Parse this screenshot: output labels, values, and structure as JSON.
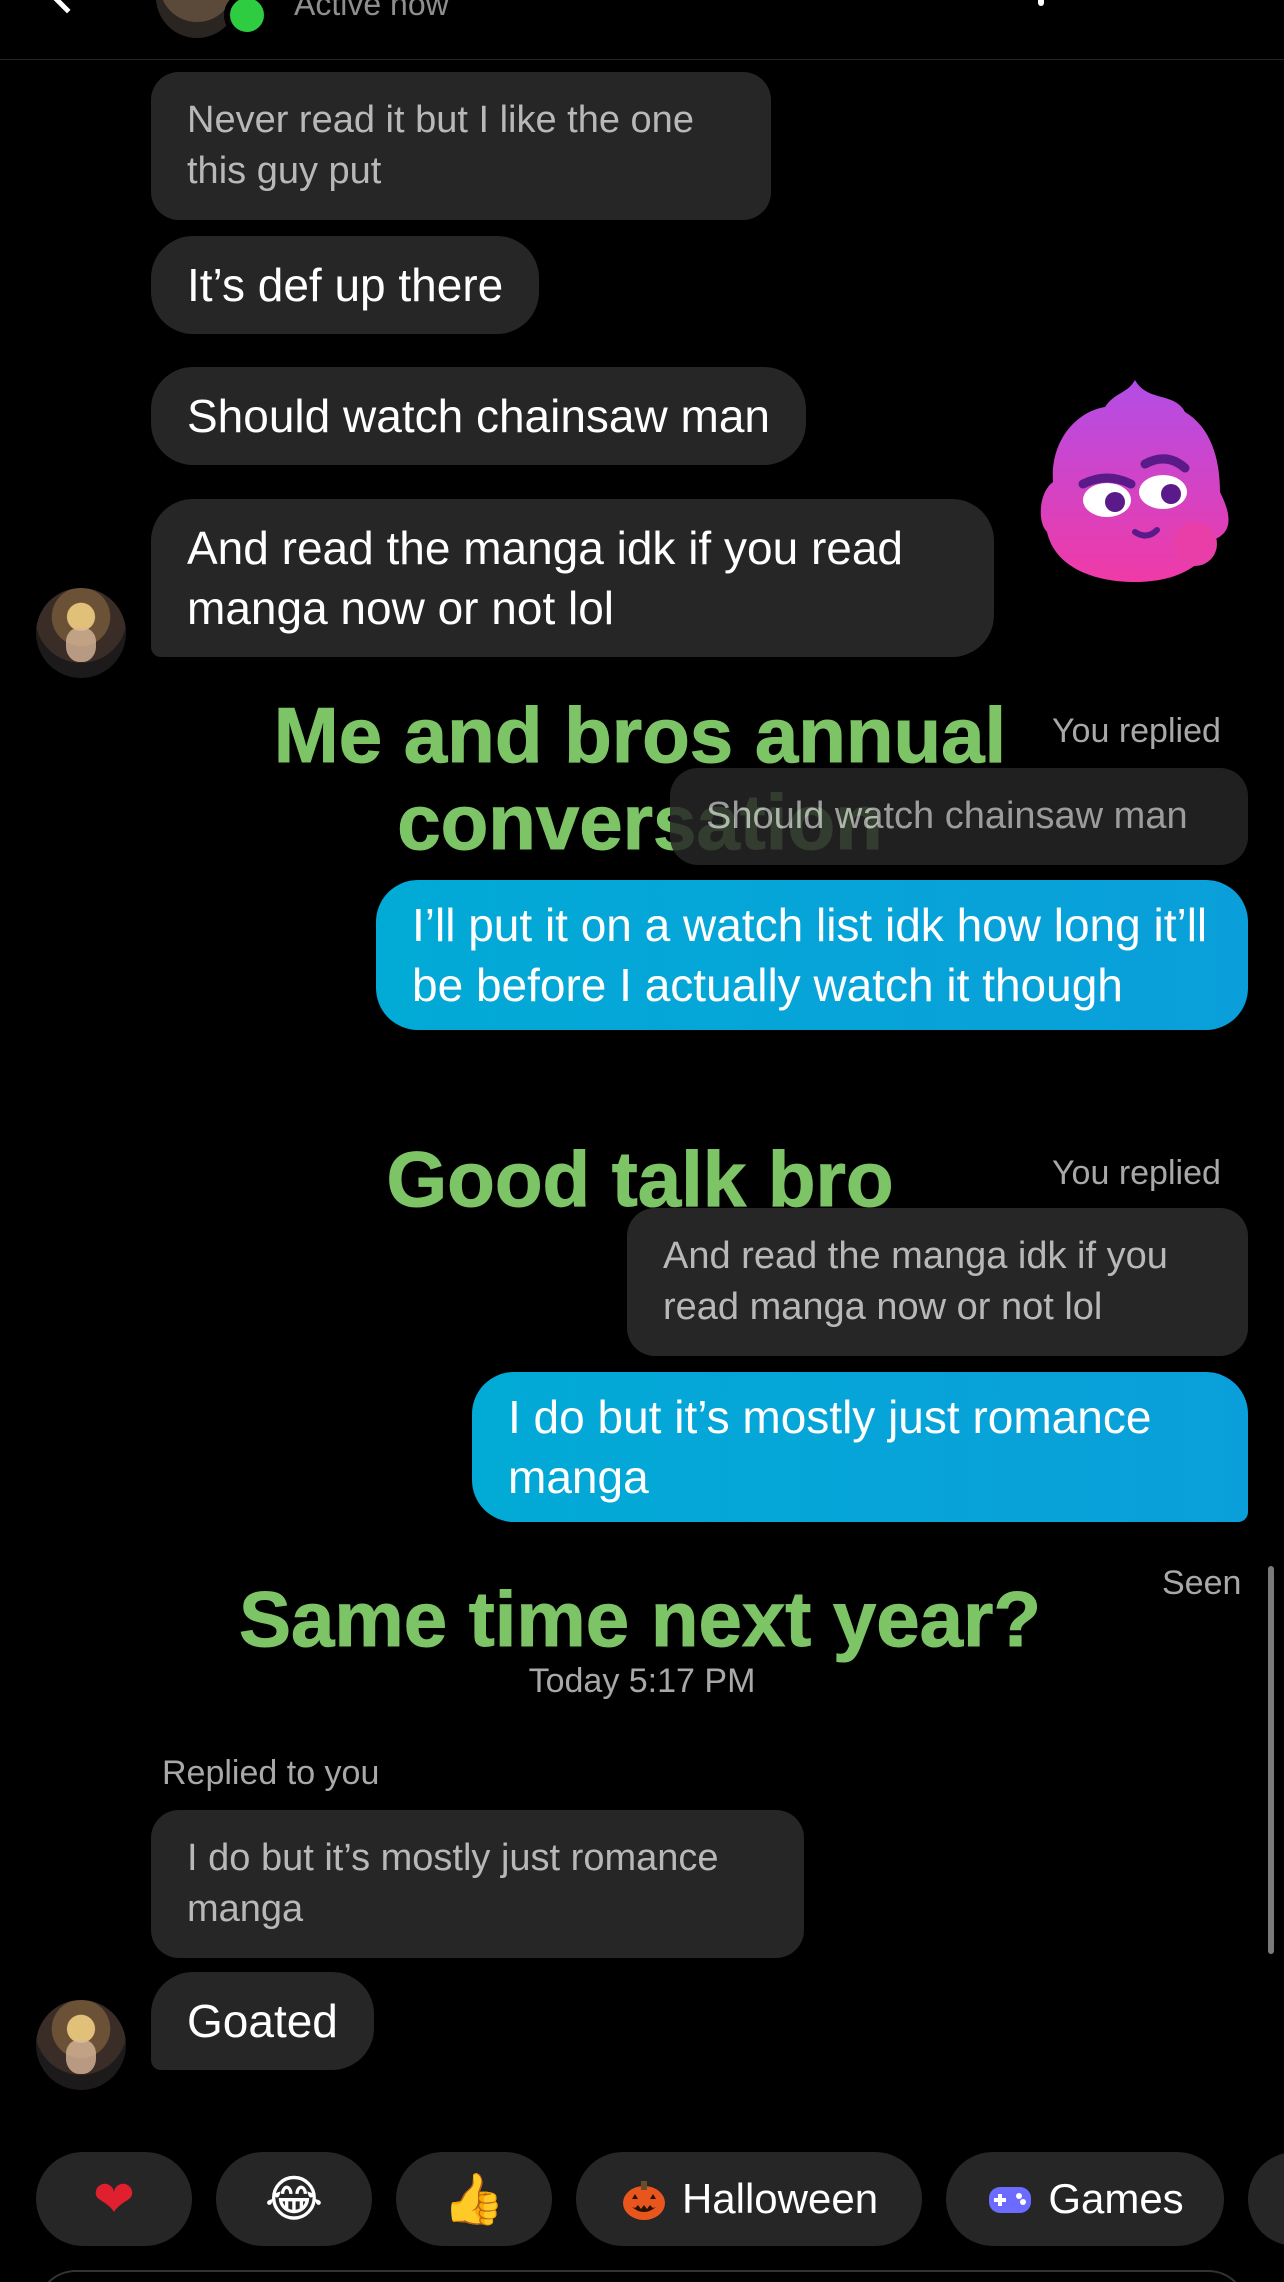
{
  "header": {
    "status": "Active now"
  },
  "messages": {
    "m1": "Never read it but I like the one this guy put",
    "m2": "It’s def up there",
    "m3": "Should watch chainsaw man",
    "m4": "And read the manga idk if you read manga now or not lol",
    "reply1_label": "You replied",
    "reply1_quote": "Should watch chainsaw man",
    "m5": "I’ll put it on a watch list idk how long it’ll be before I actually watch it though",
    "reply2_label": "You replied",
    "reply2_quote": "And read the manga idk if you read manga now or not lol",
    "m6": "I do but it’s mostly just romance manga",
    "seen": "Seen",
    "timestamp": "Today 5:17 PM",
    "reply3_label": "Replied to you",
    "reply3_quote": "I do but it’s mostly just romance manga",
    "m7": "Goated"
  },
  "captions": {
    "c1": "Me and bros annual conversation",
    "c2": "Good talk bro",
    "c3": "Same time next year?"
  },
  "quick_replies": [
    {
      "label": "",
      "icon": "heart-emoji"
    },
    {
      "label": "",
      "icon": "laughing-emoji"
    },
    {
      "label": "",
      "icon": "thumbs-up-emoji"
    },
    {
      "label": "Halloween",
      "icon": "jack-o-lantern-icon"
    },
    {
      "label": "Games",
      "icon": "gamepad-icon"
    }
  ],
  "colors": {
    "background": "#000000",
    "received_bubble": "#262626",
    "sent_bubble": "#02aad6",
    "caption_green": "#7dc466",
    "online": "#2ecc40"
  }
}
